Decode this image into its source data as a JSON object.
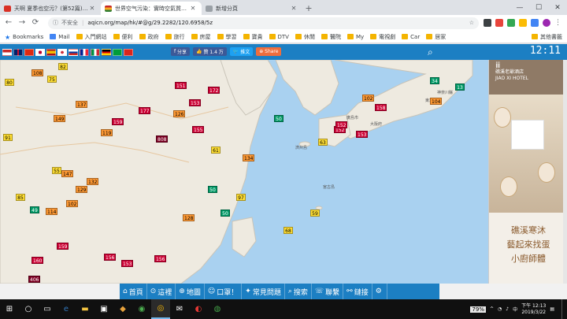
{
  "browser": {
    "tabs": [
      {
        "title": "天啊 夏季也空污？(第52篇) - 新",
        "active": false,
        "favicon": "red"
      },
      {
        "title": "世界空气污染：實時空氣質量指數",
        "active": true,
        "favicon": "flag"
      },
      {
        "title": "新增分頁",
        "active": false,
        "favicon": "blank"
      }
    ],
    "url_not_secure": "不安全",
    "url": "aqicn.org/map/hk/#@g/29.2282/120.6958/5z",
    "bookmarks": [
      "Bookmarks",
      "Mail",
      "入門網站",
      "便利",
      "政府",
      "旅行",
      "房屋",
      "學習",
      "寶貴",
      "DTV",
      "休閒",
      "醫院",
      "My",
      "電視劇",
      "Car",
      "居家"
    ],
    "other_bookmarks": "其他書籤"
  },
  "site": {
    "share_fb": "分享",
    "like": "贊 1.4 万",
    "tweet": "推文",
    "share": "Share",
    "clock": "12:11"
  },
  "map_labels": [
    "濟州島",
    "大阪府",
    "東京都",
    "宮古島",
    "神奈川縣",
    "廣島市"
  ],
  "markers": [
    {
      "v": "80",
      "c": "mod"
    },
    {
      "v": "108",
      "c": "usg"
    },
    {
      "v": "75",
      "c": "mod"
    },
    {
      "v": "82",
      "c": "mod"
    },
    {
      "v": "137",
      "c": "usg"
    },
    {
      "v": "91",
      "c": "mod"
    },
    {
      "v": "149",
      "c": "usg"
    },
    {
      "v": "151",
      "c": "unh"
    },
    {
      "v": "172",
      "c": "unh"
    },
    {
      "v": "153",
      "c": "unh"
    },
    {
      "v": "159",
      "c": "unh"
    },
    {
      "v": "177",
      "c": "unh"
    },
    {
      "v": "119",
      "c": "usg"
    },
    {
      "v": "126",
      "c": "usg"
    },
    {
      "v": "808",
      "c": "haz"
    },
    {
      "v": "155",
      "c": "unh"
    },
    {
      "v": "147",
      "c": "usg"
    },
    {
      "v": "132",
      "c": "usg"
    },
    {
      "v": "129",
      "c": "usg"
    },
    {
      "v": "102",
      "c": "usg"
    },
    {
      "v": "49",
      "c": "good"
    },
    {
      "v": "114",
      "c": "usg"
    },
    {
      "v": "159",
      "c": "unh"
    },
    {
      "v": "160",
      "c": "unh"
    },
    {
      "v": "156",
      "c": "unh"
    },
    {
      "v": "153",
      "c": "unh"
    },
    {
      "v": "134",
      "c": "usg"
    },
    {
      "v": "128",
      "c": "usg"
    },
    {
      "v": "406",
      "c": "haz"
    },
    {
      "v": "50",
      "c": "good"
    },
    {
      "v": "50",
      "c": "good"
    },
    {
      "v": "50",
      "c": "good"
    },
    {
      "v": "63",
      "c": "mod"
    },
    {
      "v": "59",
      "c": "mod"
    },
    {
      "v": "68",
      "c": "mod"
    },
    {
      "v": "102",
      "c": "usg"
    },
    {
      "v": "158",
      "c": "unh"
    },
    {
      "v": "152",
      "c": "unh"
    },
    {
      "v": "104",
      "c": "usg"
    },
    {
      "v": "34",
      "c": "good"
    },
    {
      "v": "13",
      "c": "good"
    },
    {
      "v": "152",
      "c": "unh"
    },
    {
      "v": "153",
      "c": "unh"
    },
    {
      "v": "156",
      "c": "unh"
    },
    {
      "v": "97",
      "c": "mod"
    },
    {
      "v": "61",
      "c": "mod"
    },
    {
      "v": "55",
      "c": "mod"
    },
    {
      "v": "85",
      "c": "mod"
    }
  ],
  "ad": {
    "hotel_cn": "礁溪老爺酒店",
    "hotel_en": "JIAO XI HOTEL",
    "line1": "礁溪寒沐",
    "line2": "藝起來找蛋",
    "line3": "小廚師體"
  },
  "nav": [
    {
      "icon": "home-icon",
      "label": "首頁"
    },
    {
      "icon": "locate-icon",
      "label": "這裡"
    },
    {
      "icon": "map-icon",
      "label": "地圖"
    },
    {
      "icon": "mask-icon",
      "label": "口罩！"
    },
    {
      "icon": "faq-icon",
      "label": "常見問題"
    },
    {
      "icon": "search-icon",
      "label": "搜索"
    },
    {
      "icon": "contact-icon",
      "label": "聯繫"
    },
    {
      "icon": "link-icon",
      "label": "鏈接"
    },
    {
      "icon": "settings-icon",
      "label": ""
    }
  ],
  "taskbar": {
    "battery": "79%",
    "time": "下午 12:13",
    "date": "2019/3/22"
  }
}
